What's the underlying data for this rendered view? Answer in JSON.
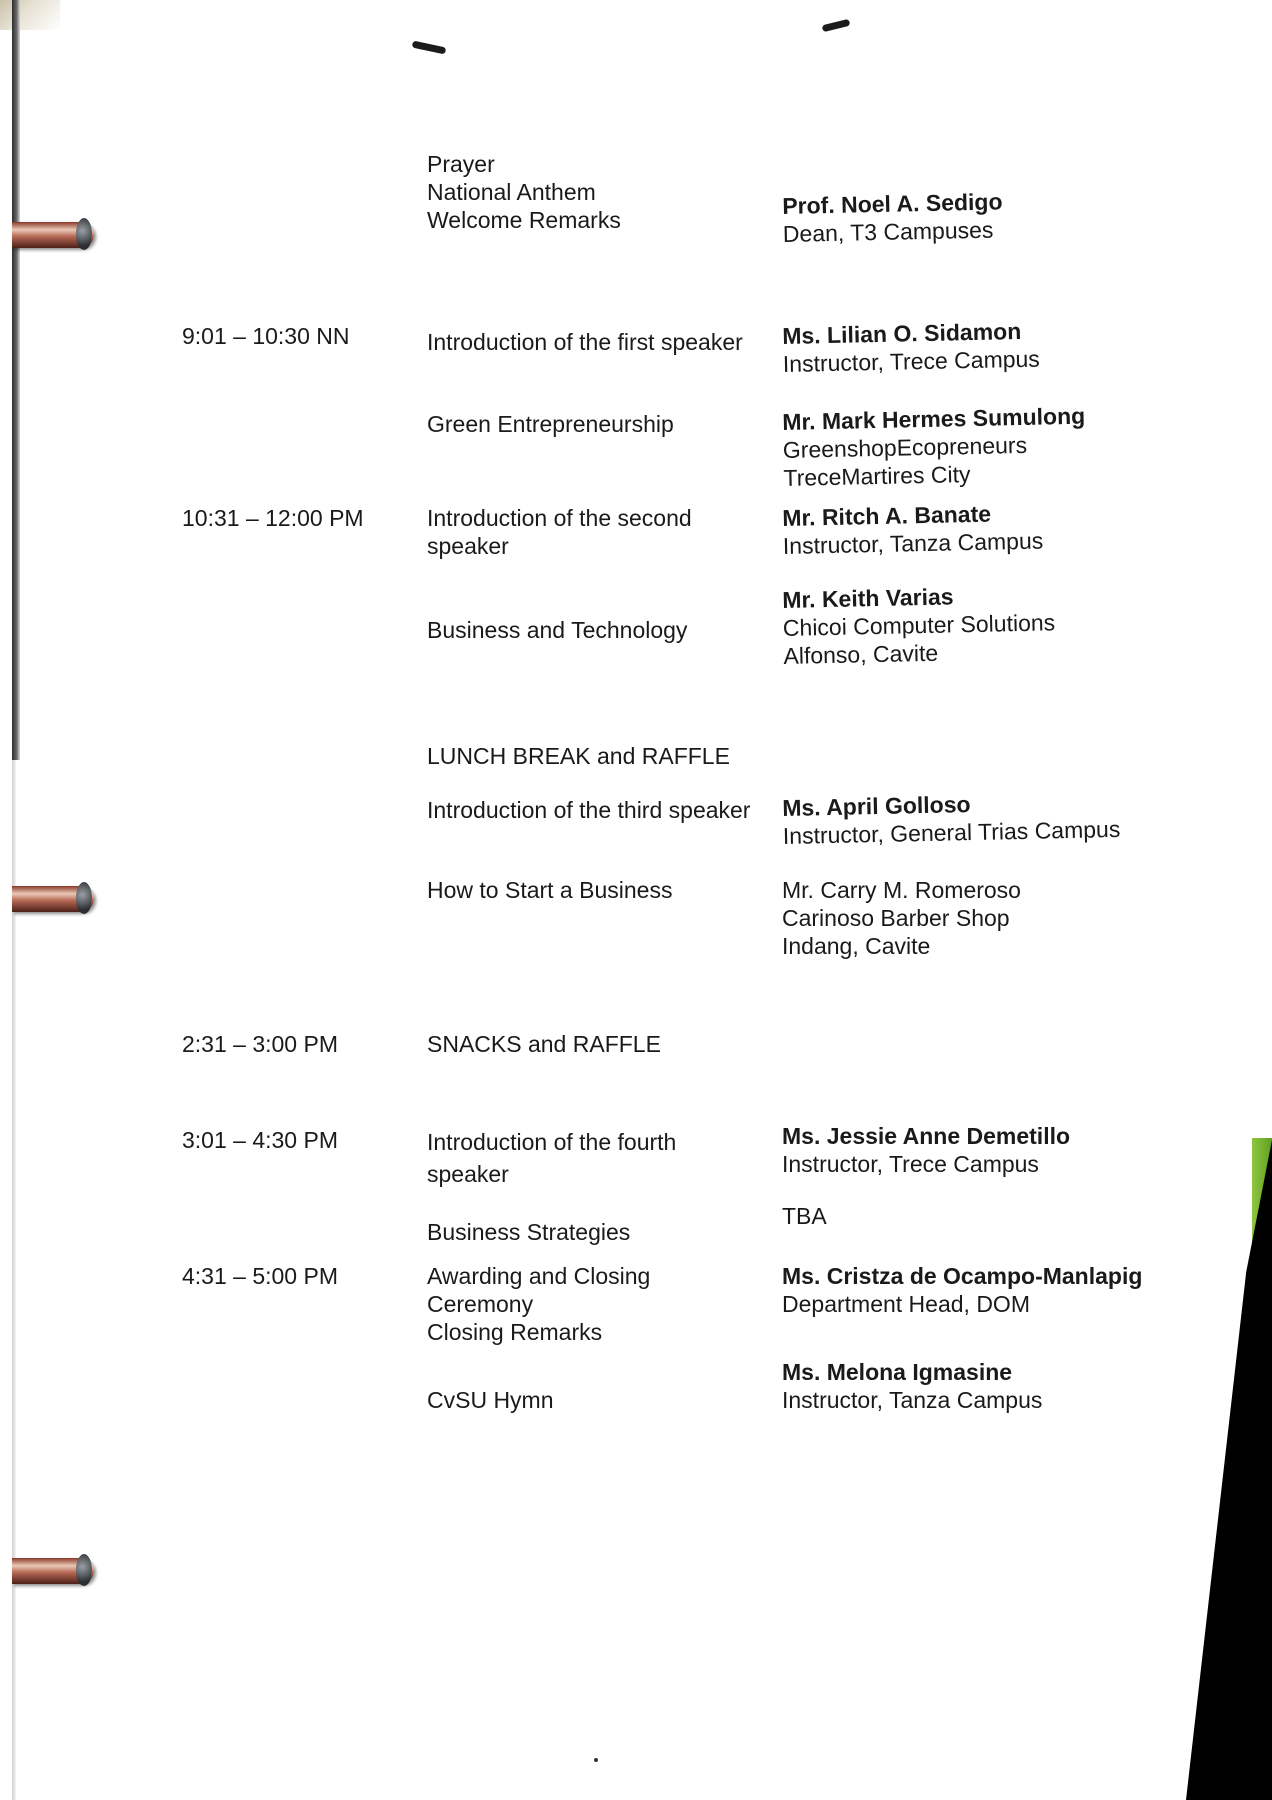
{
  "agenda": [
    {
      "time": "",
      "activity": [
        "Prayer",
        "National Anthem",
        "Welcome Remarks"
      ],
      "speaker_name": "Prof. Noel A. Sedigo",
      "speaker_details": [
        "Dean, T3 Campuses"
      ]
    },
    {
      "time": "9:01 – 10:30 NN",
      "activity": [
        "Introduction of the first speaker"
      ],
      "speaker_name": "Ms. Lilian O. Sidamon",
      "speaker_details": [
        "Instructor, Trece Campus"
      ]
    },
    {
      "time": "",
      "activity": [
        "Green Entrepreneurship"
      ],
      "speaker_name": "Mr. Mark Hermes Sumulong",
      "speaker_details": [
        "GreenshopEcopreneurs",
        "TreceMartires City"
      ]
    },
    {
      "time": "10:31 – 12:00 PM",
      "activity": [
        "Introduction of the second",
        "speaker"
      ],
      "speaker_name": "Mr. Ritch A. Banate",
      "speaker_details": [
        "Instructor, Tanza Campus"
      ]
    },
    {
      "time": "",
      "activity": [
        "Business and Technology"
      ],
      "speaker_name": "Mr. Keith Varias",
      "speaker_details": [
        "Chicoi Computer Solutions",
        "Alfonso, Cavite"
      ]
    },
    {
      "time": "",
      "activity": [
        "LUNCH BREAK and RAFFLE"
      ],
      "speaker_name": "",
      "speaker_details": []
    },
    {
      "time": "",
      "activity": [
        "Introduction of the third speaker"
      ],
      "speaker_name": "Ms. April Golloso",
      "speaker_details": [
        "Instructor, General Trias Campus"
      ]
    },
    {
      "time": "",
      "activity": [
        "How to Start a Business"
      ],
      "speaker_name": "",
      "speaker_details": [
        "Mr. Carry M. Romeroso",
        "Carinoso Barber Shop",
        "Indang, Cavite"
      ]
    },
    {
      "time": "2:31 – 3:00 PM",
      "activity": [
        "SNACKS and RAFFLE"
      ],
      "speaker_name": "",
      "speaker_details": []
    },
    {
      "time": "3:01 – 4:30 PM",
      "activity": [
        "Introduction of the fourth",
        "speaker"
      ],
      "speaker_name": "Ms. Jessie Anne Demetillo",
      "speaker_details": [
        "Instructor, Trece Campus"
      ]
    },
    {
      "time": "",
      "activity": [
        "Business Strategies"
      ],
      "speaker_name": "",
      "speaker_details": [
        "TBA"
      ]
    },
    {
      "time": "4:31 – 5:00 PM",
      "activity": [
        "Awarding and Closing",
        "Ceremony",
        "Closing Remarks"
      ],
      "speaker_name": "Ms. Cristza de Ocampo-Manlapig",
      "speaker_details": [
        "Department Head, DOM"
      ]
    },
    {
      "time": "",
      "activity": [
        "CvSU Hymn"
      ],
      "speaker_name": "Ms. Melona Igmasine",
      "speaker_details": [
        "Instructor, Tanza Campus"
      ]
    }
  ]
}
